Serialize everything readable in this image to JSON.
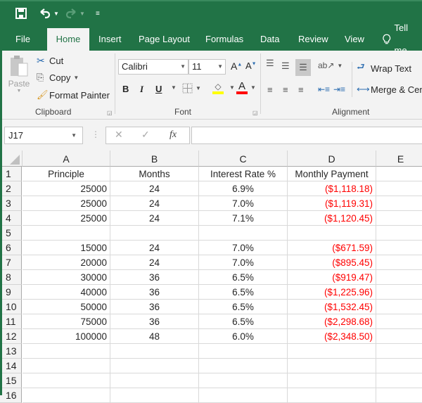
{
  "quick_access": {
    "save_icon": "save-icon",
    "undo_icon": "undo-icon",
    "redo_icon": "redo-icon",
    "customize_icon": "customize-quick-access-icon"
  },
  "tabs": [
    {
      "label": "File"
    },
    {
      "label": "Home"
    },
    {
      "label": "Insert"
    },
    {
      "label": "Page Layout"
    },
    {
      "label": "Formulas"
    },
    {
      "label": "Data"
    },
    {
      "label": "Review"
    },
    {
      "label": "View"
    },
    {
      "label": "Tell me"
    }
  ],
  "ribbon": {
    "clipboard": {
      "paste": "Paste",
      "cut": "Cut",
      "copy": "Copy",
      "format_painter": "Format Painter",
      "label": "Clipboard"
    },
    "font": {
      "font_name": "Calibri",
      "font_size": "11",
      "bold": "B",
      "italic": "I",
      "underline": "U",
      "label": "Font",
      "fill_color": "#ffff00",
      "font_color": "#ff0000"
    },
    "alignment": {
      "wrap_text": "Wrap Text",
      "merge_center": "Merge & Center",
      "label": "Alignment"
    }
  },
  "formula_bar": {
    "name_box": "J17",
    "cancel": "✕",
    "enter": "✓",
    "fx": "fx",
    "formula": ""
  },
  "sheet": {
    "columns": [
      "A",
      "B",
      "C",
      "D",
      "E"
    ],
    "row_numbers": [
      "1",
      "2",
      "3",
      "4",
      "5",
      "6",
      "7",
      "8",
      "9",
      "10",
      "11",
      "12",
      "13",
      "14",
      "15",
      "16"
    ],
    "headers": [
      "Principle",
      "Months",
      "Interest Rate %",
      "Monthly Payment"
    ],
    "rows": [
      [
        "25000",
        "24",
        "6.9%",
        "($1,118.18)"
      ],
      [
        "25000",
        "24",
        "7.0%",
        "($1,119.31)"
      ],
      [
        "25000",
        "24",
        "7.1%",
        "($1,120.45)"
      ],
      [
        "",
        "",
        "",
        ""
      ],
      [
        "15000",
        "24",
        "7.0%",
        "($671.59)"
      ],
      [
        "20000",
        "24",
        "7.0%",
        "($895.45)"
      ],
      [
        "30000",
        "36",
        "6.5%",
        "($919.47)"
      ],
      [
        "40000",
        "36",
        "6.5%",
        "($1,225.96)"
      ],
      [
        "50000",
        "36",
        "6.5%",
        "($1,532.45)"
      ],
      [
        "75000",
        "36",
        "6.5%",
        "($2,298.68)"
      ],
      [
        "100000",
        "48",
        "6.0%",
        "($2,348.50)"
      ]
    ],
    "negative_color": "#ff0000"
  }
}
